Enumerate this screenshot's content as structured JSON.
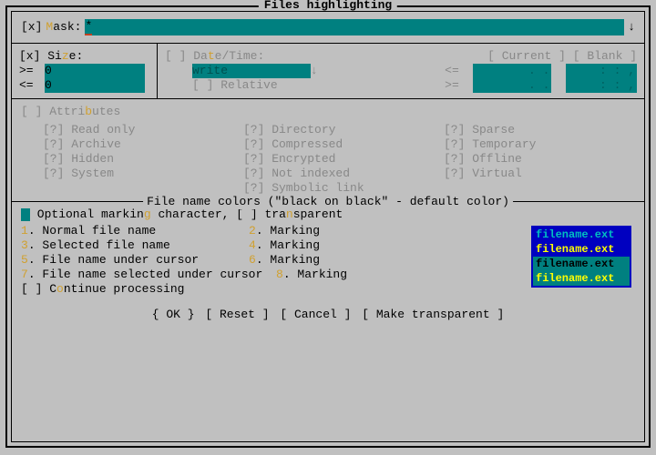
{
  "title": "Files highlighting",
  "mask": {
    "checkbox": "[x]",
    "label_pre": "",
    "hot": "M",
    "label_post": "ask:",
    "value": "*"
  },
  "size": {
    "checkbox": "[x]",
    "label_pre": "Si",
    "hot": "z",
    "label_post": "e:",
    "ge": ">=",
    "le": "<=",
    "ge_val": "0",
    "le_val": "0"
  },
  "datetime": {
    "checkbox": "[ ]",
    "label_pre": "Da",
    "hot": "t",
    "label_post": "e/Time:",
    "current": "[ Current ]",
    "blank": "[ Blank ]",
    "write": "write",
    "relative_cb": "[ ]",
    "relative": "Relative",
    "le": "<=",
    "ge": ">=",
    "date_ph": " .  .     ",
    "time_ph": " :  :  , "
  },
  "attributes": {
    "checkbox": "[ ]",
    "label_pre": "Attri",
    "hot": "b",
    "label_post": "utes",
    "col1": [
      "[?] Read only",
      "[?] Archive",
      "[?] Hidden",
      "[?] System"
    ],
    "col2": [
      "[?] Directory",
      "[?] Compressed",
      "[?] Encrypted",
      "[?] Not indexed",
      "[?] Symbolic link"
    ],
    "col3": [
      "[?] Sparse",
      "[?] Temporary",
      "[?] Offline",
      "[?] Virtual"
    ]
  },
  "colors": {
    "title": "File name colors (\"black on black\" - default color)",
    "marking_pre": " Optional markin",
    "marking_hot": "g",
    "marking_mid": " character, [ ] tra",
    "marking_hot2": "n",
    "marking_post": "sparent",
    "rows": [
      {
        "n1": "1",
        "t1": ". Normal file name",
        "n2": "2",
        "t2": ". Marking"
      },
      {
        "n1": "3",
        "t1": ". Selected file name",
        "n2": "4",
        "t2": ". Marking"
      },
      {
        "n1": "5",
        "t1": ". File name under cursor",
        "n2": "6",
        "t2": ". Marking"
      },
      {
        "n1": "7",
        "t1": ". File name selected under cursor",
        "n2": "8",
        "t2": ". Marking"
      }
    ],
    "continue_cb": "[ ]",
    "continue_pre": " C",
    "continue_hot": "o",
    "continue_post": "ntinue processing",
    "preview": "filename.ext"
  },
  "buttons": {
    "ok": "{ OK }",
    "reset": "[ Reset ]",
    "cancel": "[ Cancel ]",
    "transparent": "[ Make transparent ]"
  }
}
